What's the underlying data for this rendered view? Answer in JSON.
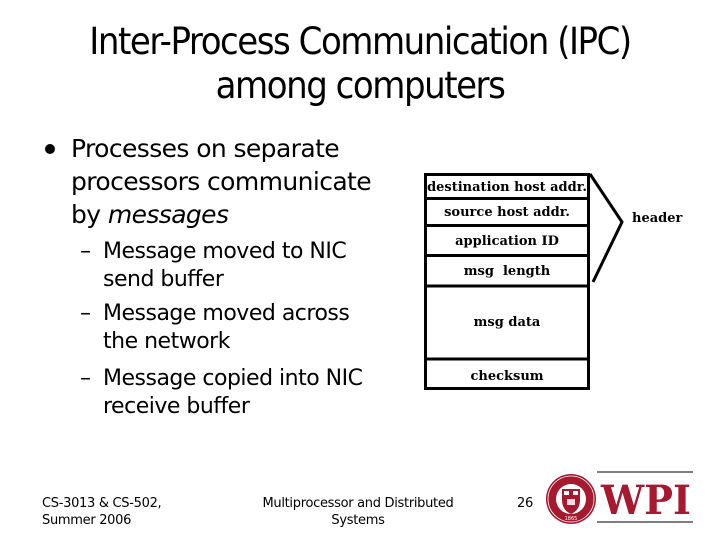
{
  "slide": {
    "title_lines": [
      "Inter-Process Communication (IPC)",
      "among computers"
    ],
    "bullet": {
      "lines": [
        "Processes on separate",
        "processors communicate"
      ],
      "last_line_prefix": "by ",
      "last_line_emphasis": "messages"
    },
    "sub_bullets": [
      {
        "dash": "–",
        "lines": [
          "Message moved to NIC",
          "send buffer"
        ]
      },
      {
        "dash": "–",
        "lines": [
          "Message moved across",
          "the network"
        ]
      },
      {
        "dash": "–",
        "lines": [
          "Message copied into NIC",
          "receive buffer"
        ]
      }
    ]
  },
  "diagram": {
    "fields": [
      "destination host addr.",
      "source host addr.",
      "application ID",
      "msg  length",
      "msg data",
      "checksum"
    ],
    "brace_label": "header",
    "header_field_count": 4
  },
  "footer": {
    "left_lines": [
      "CS-3013 & CS-502,",
      "Summer 2006"
    ],
    "center_lines": [
      "Multiprocessor and Distributed",
      "Systems"
    ],
    "page_number": "26"
  },
  "logo": {
    "text": "WPI",
    "seal_ring_text": "WORCESTER POLYTECHNIC INSTITUTE",
    "seal_year": "1865",
    "color": "#a6192e"
  }
}
